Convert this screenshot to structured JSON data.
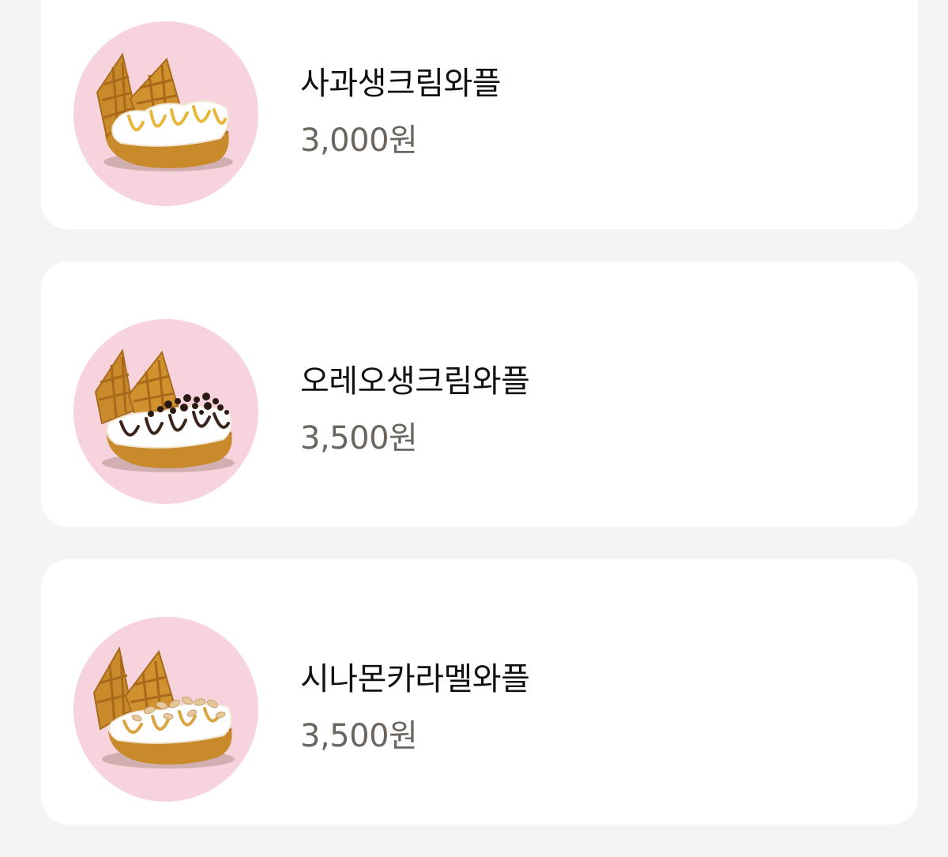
{
  "menu": {
    "items": [
      {
        "name": "사과생크림와플",
        "price": "3,000원",
        "image_icon": "apple-cream-waffle-icon",
        "topping": "apple"
      },
      {
        "name": "오레오생크림와플",
        "price": "3,500원",
        "image_icon": "oreo-cream-waffle-icon",
        "topping": "oreo"
      },
      {
        "name": "시나몬카라멜와플",
        "price": "3,500원",
        "image_icon": "cinnamon-caramel-waffle-icon",
        "topping": "cinnamon"
      }
    ]
  },
  "colors": {
    "page_background": "#f4f4f4",
    "card_background": "#ffffff",
    "thumb_circle": "#f7d3de",
    "name_text": "#111111",
    "price_text": "#6b6560",
    "waffle": "#c98a2b",
    "waffle_dark": "#a8691a",
    "cream": "#ffffff",
    "caramel": "#e8b63a",
    "chocolate": "#3a241c"
  }
}
